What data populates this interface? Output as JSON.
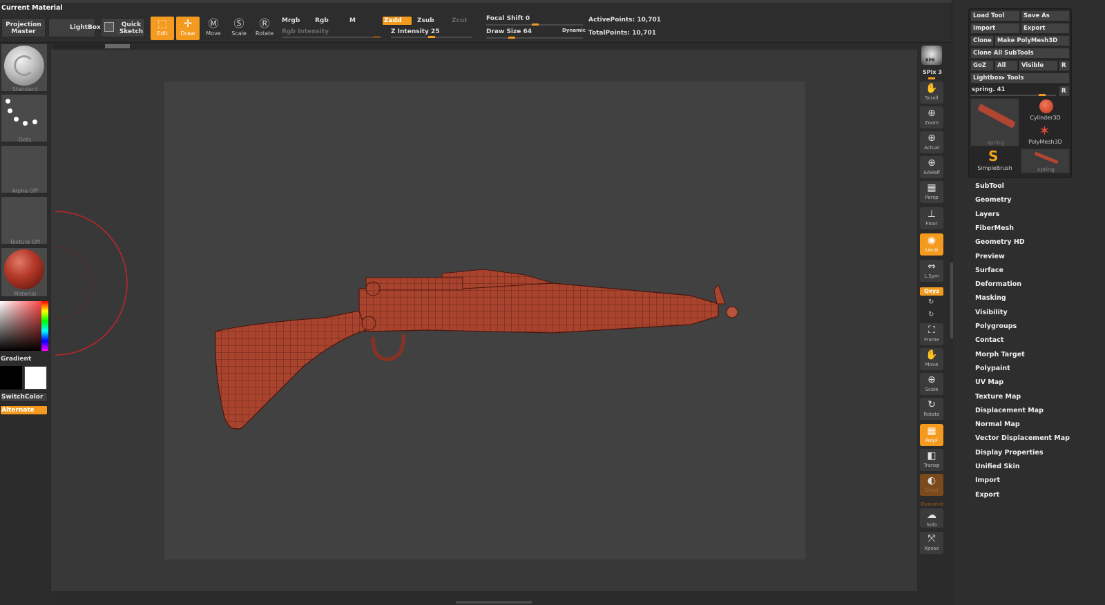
{
  "top": {
    "current_material_label": "Current Material",
    "projection_master": "Projection Master",
    "lightbox": "LightBox",
    "quick_sketch": "Quick Sketch",
    "tools": [
      {
        "label": "Edit",
        "active": true
      },
      {
        "label": "Draw",
        "active": true
      },
      {
        "label": "Move",
        "active": false
      },
      {
        "label": "Scale",
        "active": false
      },
      {
        "label": "Rotate",
        "active": false
      }
    ],
    "mrgb": "Mrgb",
    "rgb": "Rgb",
    "m": "M",
    "zadd": "Zadd",
    "zsub": "Zsub",
    "zcut": "Zcut",
    "rgb_intensity": "Rgb Intensity",
    "z_intensity": "Z Intensity 25",
    "focal_shift": "Focal Shift 0",
    "draw_size": "Draw Size 64",
    "dynamic": "Dynamic",
    "active_points": "ActivePoints: 10,701",
    "total_points": "TotalPoints: 10,701"
  },
  "left_shelf": {
    "brush": "Standard",
    "stroke": "Dots",
    "alpha": "Alpha Off",
    "texture": "Texture Off",
    "material": "Material",
    "gradient": "Gradient",
    "switch_color": "SwitchColor",
    "alternate": "Alternate"
  },
  "right_shelf": {
    "bpr": "BPR",
    "spix": "SPix 3",
    "buttons": [
      {
        "label": "Scroll",
        "icon": "hand-icon",
        "state": "normal"
      },
      {
        "label": "Zoom",
        "icon": "zoom-icon",
        "state": "normal"
      },
      {
        "label": "Actual",
        "icon": "actual-icon",
        "state": "normal"
      },
      {
        "label": "AAHalf",
        "icon": "aahalf-icon",
        "state": "normal"
      },
      {
        "label": "Persp",
        "icon": "persp-icon",
        "state": "normal"
      },
      {
        "label": "Floor",
        "icon": "floor-icon",
        "state": "normal"
      },
      {
        "label": "Local",
        "icon": "local-icon",
        "state": "orange"
      },
      {
        "label": "L.Sym",
        "icon": "lsym-icon",
        "state": "normal"
      }
    ],
    "xyz": "Qxyz",
    "buttons2": [
      {
        "label": "Frame",
        "icon": "frame-icon",
        "state": "normal"
      },
      {
        "label": "Move",
        "icon": "move-icon",
        "state": "normal"
      },
      {
        "label": "Scale",
        "icon": "scale-icon",
        "state": "normal"
      },
      {
        "label": "Rotate",
        "icon": "rotate-icon",
        "state": "normal"
      },
      {
        "label": "PolyF",
        "icon": "polyf-icon",
        "state": "orange"
      },
      {
        "label": "Transp",
        "icon": "transp-icon",
        "state": "normal"
      },
      {
        "label": "Ghost",
        "icon": "ghost-icon",
        "state": "dim"
      }
    ],
    "dynamic": "Dynamic",
    "solo": "Solo",
    "xpose": "Xpose"
  },
  "tool_panel": {
    "load_tool": "Load Tool",
    "save_as": "Save As",
    "import": "Import",
    "export": "Export",
    "clone": "Clone",
    "make_polymesh": "Make PolyMesh3D",
    "clone_all": "Clone All SubTools",
    "goz": "GoZ",
    "all": "All",
    "visible": "Visible",
    "r": "R",
    "lightbox_tools": "Lightbox▸ Tools",
    "spring": "spring. 41",
    "thumbs": [
      {
        "label": "spring"
      },
      {
        "label": "Cylinder3D"
      },
      {
        "label": "PolyMesh3D"
      },
      {
        "label": "SimpleBrush"
      },
      {
        "label": "spring"
      }
    ]
  },
  "menu": [
    "SubTool",
    "Geometry",
    "Layers",
    "FiberMesh",
    "Geometry HD",
    "Preview",
    "Surface",
    "Deformation",
    "Masking",
    "Visibility",
    "Polygroups",
    "Contact",
    "Morph Target",
    "Polypaint",
    "UV Map",
    "Texture Map",
    "Displacement Map",
    "Normal Map",
    "Vector Displacement Map",
    "Display Properties",
    "Unified Skin",
    "Import",
    "Export"
  ],
  "colors": {
    "accent": "#f39a1f",
    "model": "#a8432e",
    "background": "#383838"
  }
}
